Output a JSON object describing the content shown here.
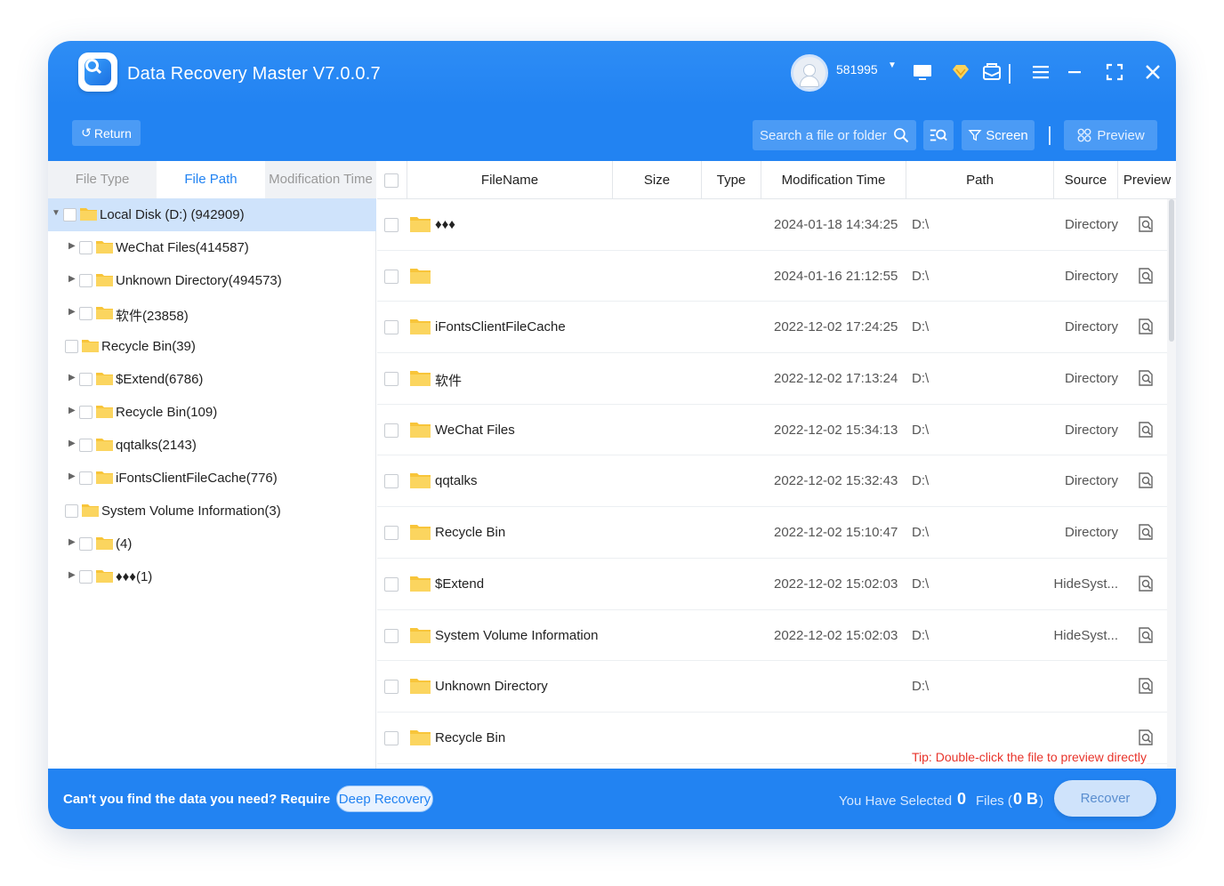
{
  "app": {
    "title": "Data Recovery Master V7.0.0.7"
  },
  "user": {
    "id": "581995"
  },
  "colors": {
    "accent": "#2283f2",
    "folder": "#f8c53a",
    "tip": "#e8332a",
    "selected_row": "#cfe3fb"
  },
  "icons": {
    "titlebar": [
      "monitor-icon",
      "diamond-icon",
      "mail-icon",
      "menu-icon",
      "minimize-icon",
      "maximize-icon",
      "close-icon"
    ],
    "toolbar": [
      "return-icon",
      "search-icon",
      "list-search-icon",
      "filter-icon",
      "preview-grid-icon"
    ]
  },
  "toolbar": {
    "return_label": "Return",
    "search_placeholder": "Search a file or folder",
    "screen_label": "Screen",
    "preview_label": "Preview"
  },
  "left_tabs": [
    {
      "label": "File Type"
    },
    {
      "label": "File Path"
    },
    {
      "label": "Modification Time"
    }
  ],
  "tree": [
    {
      "label": "Local Disk   (D:)  (942909)"
    },
    {
      "label": "WeChat Files(414587)"
    },
    {
      "label": "Unknown Directory(494573)"
    },
    {
      "label": "软件(23858)"
    },
    {
      "label": "Recycle Bin(39)"
    },
    {
      "label": "$Extend(6786)"
    },
    {
      "label": "Recycle Bin(109)"
    },
    {
      "label": "qqtalks(2143)"
    },
    {
      "label": "iFontsClientFileCache(776)"
    },
    {
      "label": "System Volume Information(3)"
    },
    {
      "label": "(4)"
    },
    {
      "label": "♦♦♦(1)"
    }
  ],
  "table": {
    "headers": [
      "FileName",
      "Size",
      "Type",
      "Modification Time",
      "Path",
      "Source",
      "Preview"
    ],
    "rows": [
      {
        "name": "♦♦♦",
        "mtime": "2024-01-18 14:34:25",
        "path": "D:\\",
        "source": "Directory"
      },
      {
        "name": "",
        "mtime": "2024-01-16 21:12:55",
        "path": "D:\\",
        "source": "Directory"
      },
      {
        "name": "iFontsClientFileCache",
        "mtime": "2022-12-02 17:24:25",
        "path": "D:\\",
        "source": "Directory"
      },
      {
        "name": "软件",
        "mtime": "2022-12-02 17:13:24",
        "path": "D:\\",
        "source": "Directory"
      },
      {
        "name": "WeChat Files",
        "mtime": "2022-12-02 15:34:13",
        "path": "D:\\",
        "source": "Directory"
      },
      {
        "name": "qqtalks",
        "mtime": "2022-12-02 15:32:43",
        "path": "D:\\",
        "source": "Directory"
      },
      {
        "name": "Recycle Bin",
        "mtime": "2022-12-02 15:10:47",
        "path": "D:\\",
        "source": "Directory"
      },
      {
        "name": "$Extend",
        "mtime": "2022-12-02 15:02:03",
        "path": "D:\\",
        "source": "HideSyst..."
      },
      {
        "name": "System Volume Information",
        "mtime": "2022-12-02 15:02:03",
        "path": "D:\\",
        "source": "HideSyst..."
      },
      {
        "name": "Unknown Directory",
        "mtime": "",
        "path": "D:\\",
        "source": ""
      },
      {
        "name": "Recycle Bin",
        "mtime": "",
        "path": "",
        "source": ""
      }
    ]
  },
  "tip": "Tip: Double-click the file to preview directly",
  "footer": {
    "message": "Can't you find the data you need? Require",
    "deep_recovery_label": "Deep Recovery",
    "selected_label": "You Have Selected",
    "selected_count": "0",
    "files_label": "Files (",
    "selected_size": "0 B",
    "close_paren": ")",
    "recover_label": "Recover"
  }
}
